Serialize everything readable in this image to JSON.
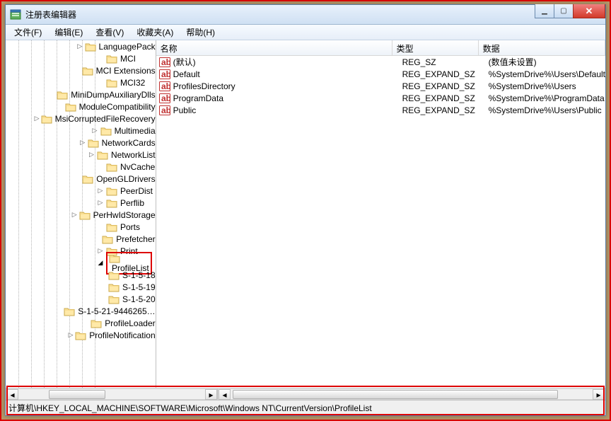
{
  "window": {
    "title": "注册表编辑器"
  },
  "menu": {
    "file": "文件(F)",
    "edit": "编辑(E)",
    "view": "查看(V)",
    "favorites": "收藏夹(A)",
    "help": "帮助(H)"
  },
  "tree": {
    "indent_base": 128,
    "child_indent": 148,
    "items": [
      {
        "label": "LanguagePack",
        "exp": "▷"
      },
      {
        "label": "MCI",
        "exp": ""
      },
      {
        "label": "MCI Extensions",
        "exp": ""
      },
      {
        "label": "MCI32",
        "exp": ""
      },
      {
        "label": "MiniDumpAuxiliaryDlls",
        "exp": ""
      },
      {
        "label": "ModuleCompatibility",
        "exp": ""
      },
      {
        "label": "MsiCorruptedFileRecovery",
        "exp": "▷"
      },
      {
        "label": "Multimedia",
        "exp": "▷"
      },
      {
        "label": "NetworkCards",
        "exp": "▷"
      },
      {
        "label": "NetworkList",
        "exp": "▷"
      },
      {
        "label": "NvCache",
        "exp": ""
      },
      {
        "label": "OpenGLDrivers",
        "exp": ""
      },
      {
        "label": "PeerDist",
        "exp": "▷"
      },
      {
        "label": "Perflib",
        "exp": "▷"
      },
      {
        "label": "PerHwIdStorage",
        "exp": "▷"
      },
      {
        "label": "Ports",
        "exp": ""
      },
      {
        "label": "Prefetcher",
        "exp": ""
      },
      {
        "label": "Print",
        "exp": "▷"
      },
      {
        "label": "ProfileList",
        "exp": "◢",
        "selected": true,
        "highlight": true
      },
      {
        "label": "S-1-5-18",
        "exp": "",
        "child": true
      },
      {
        "label": "S-1-5-19",
        "exp": "",
        "child": true
      },
      {
        "label": "S-1-5-20",
        "exp": "",
        "child": true
      },
      {
        "label": "S-1-5-21-9446265…",
        "exp": "",
        "child": true
      },
      {
        "label": "ProfileLoader",
        "exp": ""
      },
      {
        "label": "ProfileNotification",
        "exp": "▷"
      }
    ]
  },
  "columns": {
    "name": "名称",
    "type": "类型",
    "data": "数据"
  },
  "values": [
    {
      "name": "(默认)",
      "type": "REG_SZ",
      "data": "(数值未设置)"
    },
    {
      "name": "Default",
      "type": "REG_EXPAND_SZ",
      "data": "%SystemDrive%\\Users\\Default"
    },
    {
      "name": "ProfilesDirectory",
      "type": "REG_EXPAND_SZ",
      "data": "%SystemDrive%\\Users"
    },
    {
      "name": "ProgramData",
      "type": "REG_EXPAND_SZ",
      "data": "%SystemDrive%\\ProgramData"
    },
    {
      "name": "Public",
      "type": "REG_EXPAND_SZ",
      "data": "%SystemDrive%\\Users\\Public"
    }
  ],
  "statusbar": {
    "path": "计算机\\HKEY_LOCAL_MACHINE\\SOFTWARE\\Microsoft\\Windows NT\\CurrentVersion\\ProfileList"
  }
}
